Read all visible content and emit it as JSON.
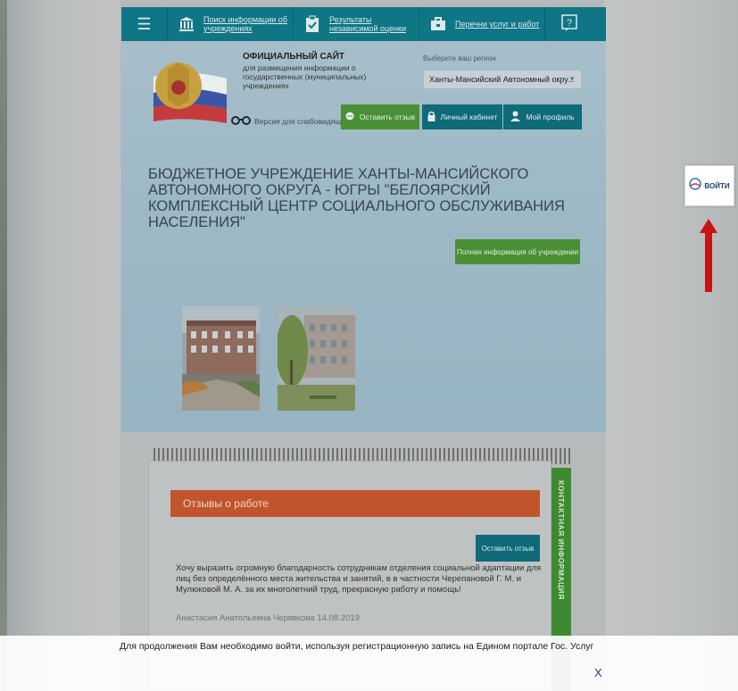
{
  "nav": {
    "items": [
      {
        "label": "Поиск информации об учреждениях"
      },
      {
        "label": "Результаты независимой оценки"
      },
      {
        "label": "Перечни услуг и работ"
      }
    ]
  },
  "site": {
    "title": "ОФИЦИАЛЬНЫЙ САЙТ",
    "subtitle": "для размещения информации о государственных (муниципальных) учреждениях",
    "vision_label": "Версия для слабовидящих"
  },
  "region": {
    "label": "Выберите ваш регион",
    "selected": "Ханты-Мансийский Автономный окру..."
  },
  "buttons": {
    "feedback": "Оставить отзыв",
    "cabinet": "Личный кабинет",
    "profile": "Мой профиль",
    "full_info": "Полная информация об учреждении"
  },
  "organization": {
    "name": "БЮДЖЕТНОЕ УЧРЕЖДЕНИЕ ХАНТЫ-МАНСИЙСКОГО АВТОНОМНОГО ОКРУГА - ЮГРЫ \"БЕЛОЯРСКИЙ КОМПЛЕКСНЫЙ ЦЕНТР СОЦИАЛЬНОГО ОБСЛУЖИВАНИЯ НАСЕЛЕНИЯ\""
  },
  "reviews": {
    "header": "Отзывы о работе",
    "leave_button": "Оставить отзыв",
    "items": [
      {
        "text": "Хочу выразить огромную благодарность сотрудникам отделения социальной адаптации для лиц без определённого места жительства и занятий, в в частности Черепановой Г. М. и Мулюковой М. А. за их многолетний труд, прекрасную работу и помощь!",
        "author": "Анастасия Анатольевна Черявкова 14.08.2019"
      }
    ],
    "side_tab": "КОНТАКТНАЯ ИНФОРМАЦИЯ"
  },
  "login_widget": {
    "label": "ВОЙТИ"
  },
  "notice": {
    "text": "Для продолжения Вам необходимо войти, используя регистрационную запись на Едином портале Гос. Услуг",
    "close": "X"
  },
  "colors": {
    "nav_bg": "#0f7686",
    "green_button": "#4a8f36",
    "teal_button": "#0f6a79",
    "reviews_header": "#c0552b",
    "arrow": "#c81414"
  }
}
